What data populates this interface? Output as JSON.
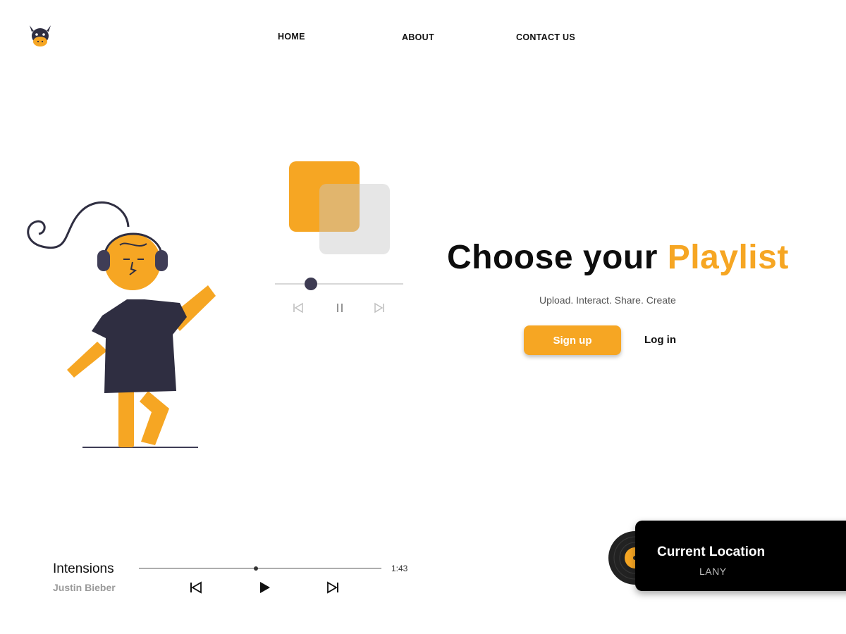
{
  "nav": {
    "links": [
      "HOME",
      "ABOUT",
      "CONTACT US"
    ],
    "logo_icon": "cow-logo-icon"
  },
  "hero": {
    "title_main": "Choose your ",
    "title_accent": "Playlist",
    "subtitle": "Upload. Interact. Share. Create",
    "signup_label": "Sign up",
    "login_label": "Log in"
  },
  "mini_player": {
    "progress": 0.24,
    "icons": [
      "skip-back-icon",
      "pause-icon",
      "skip-forward-icon"
    ]
  },
  "player": {
    "song_title": "Intensions",
    "artist": "Justin Bieber",
    "time": "1:43",
    "progress": 0.48,
    "icons": [
      "skip-back-icon",
      "play-icon",
      "skip-forward-icon"
    ]
  },
  "now_playing": {
    "title": "Current Location",
    "artist": "LANY",
    "icon": "vinyl-record-icon"
  },
  "colors": {
    "accent": "#f6a623",
    "dark": "#2f2e41",
    "card_bg": "#000000"
  }
}
